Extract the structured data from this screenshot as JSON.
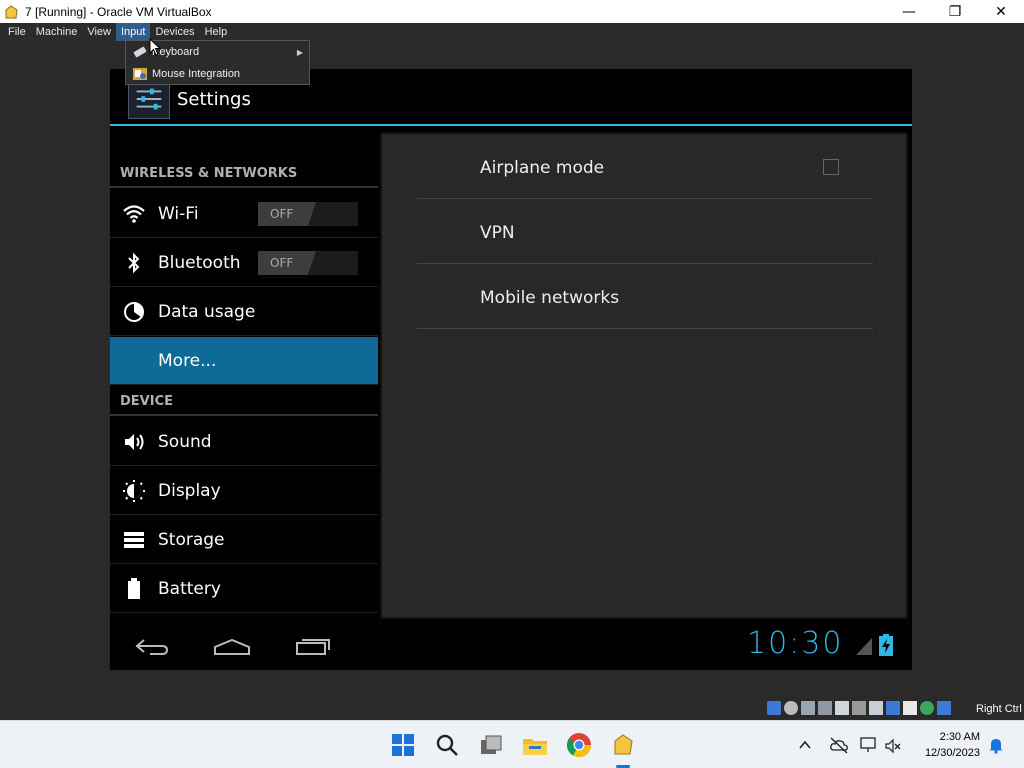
{
  "window": {
    "title": "7 [Running] - Oracle VM VirtualBox",
    "minimize": "—",
    "maximize": "❐",
    "close": "✕"
  },
  "menubar": [
    "File",
    "Machine",
    "View",
    "Input",
    "Devices",
    "Help"
  ],
  "active_menu": "Input",
  "input_menu": {
    "items": [
      {
        "label": "Keyboard",
        "icon": "keyboard-icon",
        "submenu": true
      },
      {
        "label": "Mouse Integration",
        "icon": "mouse-integration-icon",
        "submenu": false
      }
    ]
  },
  "android": {
    "action_bar_title": "Settings",
    "sections": {
      "wireless": "WIRELESS & NETWORKS",
      "device": "DEVICE"
    },
    "wireless_items": [
      {
        "label": "Wi-Fi",
        "toggle": "OFF",
        "icon": "wifi-icon"
      },
      {
        "label": "Bluetooth",
        "toggle": "OFF",
        "icon": "bluetooth-icon"
      },
      {
        "label": "Data usage",
        "icon": "data-usage-icon"
      },
      {
        "label": "More...",
        "selected": true
      }
    ],
    "device_items": [
      {
        "label": "Sound",
        "icon": "sound-icon"
      },
      {
        "label": "Display",
        "icon": "display-icon"
      },
      {
        "label": "Storage",
        "icon": "storage-icon"
      },
      {
        "label": "Battery",
        "icon": "battery-icon"
      }
    ],
    "detail_items": [
      {
        "label": "Airplane mode",
        "checkbox": true,
        "checked": false
      },
      {
        "label": "VPN"
      },
      {
        "label": "Mobile networks"
      }
    ],
    "clock": "10:30",
    "accent_color": "#33b5e5",
    "selected_color": "#0e6a96"
  },
  "statusbar": {
    "host_key": "Right Ctrl"
  },
  "taskbar": {
    "time": "2:30 AM",
    "date": "12/30/2023"
  }
}
